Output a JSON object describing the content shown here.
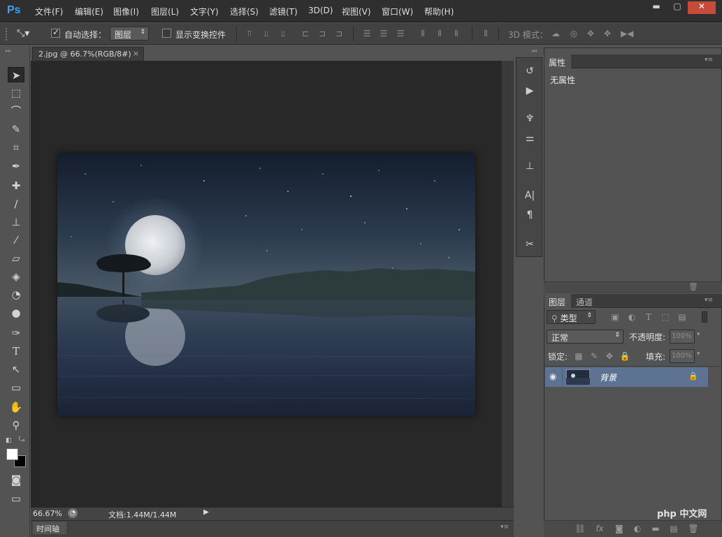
{
  "app": {
    "logo": "Ps"
  },
  "menu": [
    "文件(F)",
    "编辑(E)",
    "图像(I)",
    "图层(L)",
    "文字(Y)",
    "选择(S)",
    "滤镜(T)",
    "3D(D)",
    "视图(V)",
    "窗口(W)",
    "帮助(H)"
  ],
  "window_controls": {
    "minimize": "▬",
    "maximize": "▢",
    "close": "✕"
  },
  "options": {
    "auto_select_label": "自动选择：",
    "auto_select_checked": true,
    "auto_select_target": "图层",
    "show_transform_label": "显示变换控件",
    "show_transform_checked": false,
    "mode_3d_label": "3D 模式："
  },
  "document": {
    "tab_title": "2.jpg @ 66.7%(RGB/8#)",
    "tab_close": "×",
    "zoom": "66.67%",
    "doc_size": "文档:1.44M/1.44M",
    "timeline_label": "时间轴"
  },
  "properties_panel": {
    "title": "属性",
    "content": "无属性"
  },
  "layers_panel": {
    "tabs": [
      "图层",
      "通道"
    ],
    "filter_type": "类型",
    "blend_mode": "正常",
    "opacity_label": "不透明度:",
    "opacity_value": "100%",
    "lock_label": "锁定:",
    "fill_label": "填充:",
    "fill_value": "100%",
    "layers": [
      {
        "name": "背景",
        "visible": true,
        "locked": true
      }
    ]
  },
  "watermark": "php 中文网",
  "colors": {
    "accent": "#3aa2ff",
    "layer_selected": "#5d7391"
  }
}
